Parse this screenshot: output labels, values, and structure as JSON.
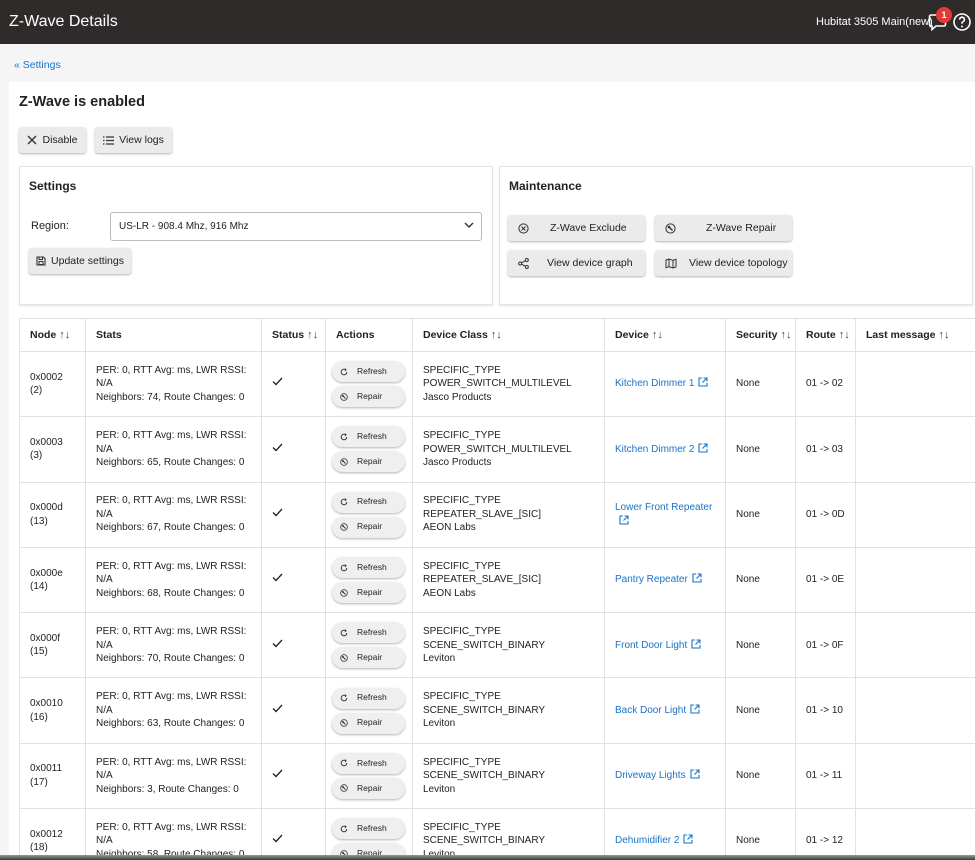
{
  "header": {
    "title": "Z-Wave Details",
    "hub_name": "Hubitat 3505 Main(new)",
    "notification_count": "1"
  },
  "breadcrumb": "« Settings",
  "page_title": "Z-Wave is enabled",
  "toolbar": {
    "disable_label": "Disable",
    "view_logs_label": "View logs"
  },
  "settings": {
    "title": "Settings",
    "region_label": "Region:",
    "region_value": "US-LR - 908.4 Mhz, 916 Mhz",
    "update_label": "Update settings"
  },
  "maintenance": {
    "title": "Maintenance",
    "exclude_label": "Z-Wave Exclude",
    "repair_label": "Z-Wave Repair",
    "graph_label": "View device graph",
    "topology_label": "View device topology"
  },
  "table": {
    "columns": [
      "Node",
      "Stats",
      "Status",
      "Actions",
      "Device Class",
      "Device",
      "Security",
      "Route",
      "Last message"
    ],
    "sort_glyph": "↑↓",
    "refresh_label": "Refresh",
    "repair_label": "Repair",
    "rows": [
      {
        "node": "0x0002",
        "node_dec": "(2)",
        "stats1": "PER: 0, RTT Avg: ms, LWR RSSI: N/A",
        "stats2": "Neighbors: 74, Route Changes: 0",
        "class1": "SPECIFIC_TYPE",
        "class2": "POWER_SWITCH_MULTILEVEL",
        "class3": "Jasco Products",
        "device": "Kitchen Dimmer 1",
        "security": "None",
        "route": "01 -> 02",
        "last_message": ""
      },
      {
        "node": "0x0003",
        "node_dec": "(3)",
        "stats1": "PER: 0, RTT Avg: ms, LWR RSSI: N/A",
        "stats2": "Neighbors: 65, Route Changes: 0",
        "class1": "SPECIFIC_TYPE",
        "class2": "POWER_SWITCH_MULTILEVEL",
        "class3": "Jasco Products",
        "device": "Kitchen Dimmer 2",
        "security": "None",
        "route": "01 -> 03",
        "last_message": ""
      },
      {
        "node": "0x000d",
        "node_dec": "(13)",
        "stats1": "PER: 0, RTT Avg: ms, LWR RSSI: N/A",
        "stats2": "Neighbors: 67, Route Changes: 0",
        "class1": "SPECIFIC_TYPE",
        "class2": "REPEATER_SLAVE_[SIC]",
        "class3": "AEON Labs",
        "device": "Lower Front Repeater",
        "security": "None",
        "route": "01 -> 0D",
        "last_message": ""
      },
      {
        "node": "0x000e",
        "node_dec": "(14)",
        "stats1": "PER: 0, RTT Avg: ms, LWR RSSI: N/A",
        "stats2": "Neighbors: 68, Route Changes: 0",
        "class1": "SPECIFIC_TYPE",
        "class2": "REPEATER_SLAVE_[SIC]",
        "class3": "AEON Labs",
        "device": "Pantry Repeater",
        "security": "None",
        "route": "01 -> 0E",
        "last_message": ""
      },
      {
        "node": "0x000f",
        "node_dec": "(15)",
        "stats1": "PER: 0, RTT Avg: ms, LWR RSSI: N/A",
        "stats2": "Neighbors: 70, Route Changes: 0",
        "class1": "SPECIFIC_TYPE",
        "class2": "SCENE_SWITCH_BINARY",
        "class3": "Leviton",
        "device": "Front Door Light",
        "security": "None",
        "route": "01 -> 0F",
        "last_message": ""
      },
      {
        "node": "0x0010",
        "node_dec": "(16)",
        "stats1": "PER: 0, RTT Avg: ms, LWR RSSI: N/A",
        "stats2": "Neighbors: 63, Route Changes: 0",
        "class1": "SPECIFIC_TYPE",
        "class2": "SCENE_SWITCH_BINARY",
        "class3": "Leviton",
        "device": "Back Door Light",
        "security": "None",
        "route": "01 -> 10",
        "last_message": ""
      },
      {
        "node": "0x0011",
        "node_dec": "(17)",
        "stats1": "PER: 0, RTT Avg: ms, LWR RSSI: N/A",
        "stats2": "Neighbors: 3, Route Changes: 0",
        "class1": "SPECIFIC_TYPE",
        "class2": "SCENE_SWITCH_BINARY",
        "class3": "Leviton",
        "device": "Driveway Lights",
        "security": "None",
        "route": "01 -> 11",
        "last_message": ""
      },
      {
        "node": "0x0012",
        "node_dec": "(18)",
        "stats1": "PER: 0, RTT Avg: ms, LWR RSSI: N/A",
        "stats2": "Neighbors: 58, Route Changes: 0",
        "class1": "SPECIFIC_TYPE",
        "class2": "SCENE_SWITCH_BINARY",
        "class3": "Leviton",
        "device": "Dehumidifier 2",
        "security": "None",
        "route": "01 -> 12",
        "last_message": ""
      }
    ]
  }
}
